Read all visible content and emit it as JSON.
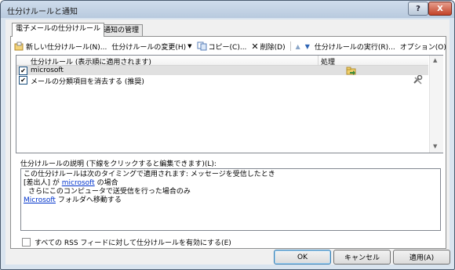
{
  "window": {
    "title": "仕分けルールと通知",
    "help_label": "?",
    "close_label": "X"
  },
  "tabs": [
    {
      "label": "電子メールの仕分けルール"
    },
    {
      "label": "通知の管理"
    }
  ],
  "toolbar": {
    "new_label": "新しい仕分けルール(N)...",
    "change_label": "仕分けルールの変更(H)",
    "copy_label": "コピー(C)...",
    "delete_label": "削除(D)",
    "run_label": "仕分けルールの実行(R)...",
    "options_label": "オプション(O)"
  },
  "rules_list": {
    "col_rule": "仕分けルール (表示順に適用されます)",
    "col_action": "処理",
    "rows": [
      {
        "name": "microsoft",
        "checked": "✔",
        "icon": "folder-move-icon"
      },
      {
        "name": "メールの分類項目を消去する (推奨)",
        "checked": "✔",
        "icon": "tools-icon"
      }
    ]
  },
  "description": {
    "label": "仕分けルールの説明 (下線をクリックすると編集できます)(L):",
    "line1": "この仕分けルールは次のタイミングで適用されます: メッセージを受信したとき",
    "line2_pre": "[差出人] が ",
    "line2_link": "microsoft",
    "line2_post": " の場合",
    "line3": "さらにこのコンピュータで送受信を行った場合のみ",
    "line4_link": "Microsoft",
    "line4_post": " フォルダへ移動する"
  },
  "rss": {
    "label": "すべての RSS フィードに対して仕分けルールを有効にする(E)",
    "checked": false
  },
  "buttons": {
    "ok": "OK",
    "cancel": "キャンセル",
    "apply": "適用(A)"
  },
  "colors": {
    "link": "#0033cc",
    "title_bar": "#c4d3e4",
    "selected_row": "#e0e0e0"
  }
}
